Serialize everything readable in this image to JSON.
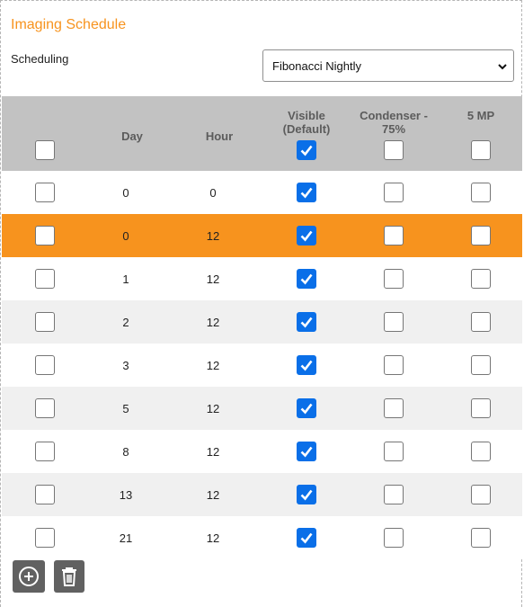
{
  "panel": {
    "title": "Imaging Schedule"
  },
  "scheduling": {
    "label": "Scheduling",
    "selected": "Fibonacci Nightly"
  },
  "table": {
    "headers": {
      "day": "Day",
      "hour": "Hour",
      "visible": "Visible (Default)",
      "condenser": "Condenser - 75%",
      "mp5": "5 MP"
    },
    "header_checks": {
      "select_all": false,
      "visible": true,
      "condenser": false,
      "mp5": false
    },
    "rows": [
      {
        "day": "0",
        "hour": "0",
        "selected": false,
        "visible": true,
        "condenser": false,
        "mp5": false
      },
      {
        "day": "0",
        "hour": "12",
        "selected": false,
        "visible": true,
        "condenser": false,
        "mp5": false
      },
      {
        "day": "1",
        "hour": "12",
        "selected": false,
        "visible": true,
        "condenser": false,
        "mp5": false
      },
      {
        "day": "2",
        "hour": "12",
        "selected": false,
        "visible": true,
        "condenser": false,
        "mp5": false
      },
      {
        "day": "3",
        "hour": "12",
        "selected": false,
        "visible": true,
        "condenser": false,
        "mp5": false
      },
      {
        "day": "5",
        "hour": "12",
        "selected": false,
        "visible": true,
        "condenser": false,
        "mp5": false
      },
      {
        "day": "8",
        "hour": "12",
        "selected": false,
        "visible": true,
        "condenser": false,
        "mp5": false
      },
      {
        "day": "13",
        "hour": "12",
        "selected": false,
        "visible": true,
        "condenser": false,
        "mp5": false
      },
      {
        "day": "21",
        "hour": "12",
        "selected": false,
        "visible": true,
        "condenser": false,
        "mp5": false
      }
    ],
    "highlighted_row": 1
  },
  "actions": {
    "add_icon": "plus-circle-icon",
    "delete_icon": "trash-icon"
  },
  "colors": {
    "accent": "#f7931e",
    "header_bg": "#c2c2c2",
    "stripe": "#f0f0f0",
    "checkbox_checked": "#0a6fe8",
    "action_btn": "#616161"
  }
}
